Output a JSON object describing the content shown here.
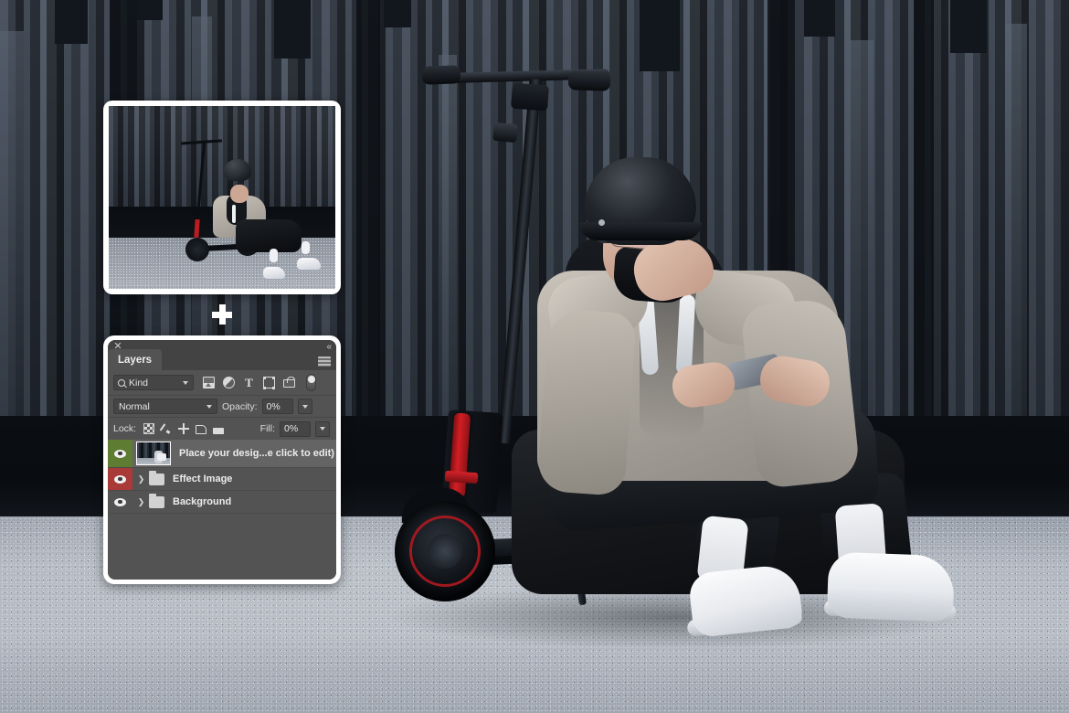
{
  "scene": {
    "description": "Street photo of a person in a helmet and gray jacket sitting on the ground beside a black electric scooter in front of a dark corrugated metal wall"
  },
  "preview": {
    "label": "design-preview-thumbnail"
  },
  "marker": {
    "icon": "plus-icon"
  },
  "panel": {
    "close_label": "✕",
    "collapse_label": "«",
    "tab_label": "Layers",
    "menu_icon": "panel-menu-icon",
    "filter": {
      "kind_label": "Kind",
      "search_icon": "search-icon",
      "caret_icon": "chevron-down-icon",
      "icons": [
        "image-filter-icon",
        "adjustment-filter-icon",
        "type-filter-icon",
        "shape-filter-icon",
        "smart-object-filter-icon",
        "filter-toggle-switch"
      ],
      "type_glyph": "T"
    },
    "blend": {
      "mode": "Normal",
      "opacity_label": "Opacity:",
      "opacity_value": "0%",
      "caret_icon": "chevron-down-icon"
    },
    "lock": {
      "label": "Lock:",
      "icons": [
        "lock-transparency-icon",
        "lock-image-pixels-icon",
        "lock-position-icon",
        "lock-artboard-icon",
        "lock-all-icon"
      ],
      "fill_label": "Fill:",
      "fill_value": "0%"
    },
    "layers": [
      {
        "name": "Place your desig...e click to edit)",
        "visible": true,
        "selected": true,
        "eye_color": "#5f7c33",
        "type": "smart-object",
        "has_thumb": true
      },
      {
        "name": "Effect Image",
        "visible": true,
        "selected": false,
        "eye_color": "#a93a38",
        "type": "group",
        "expand_icon": "chevron-right-icon"
      },
      {
        "name": "Background",
        "visible": true,
        "selected": false,
        "eye_color": "#535353",
        "type": "group",
        "expand_icon": "chevron-right-icon"
      }
    ]
  },
  "colors": {
    "panel_bg": "#535353",
    "panel_chrome": "#434343",
    "panel_frame": "#ffffff",
    "selected_row": "#646464",
    "eye_green": "#5f7c33",
    "eye_red": "#a93a38",
    "scooter_accent": "#b5181f"
  }
}
